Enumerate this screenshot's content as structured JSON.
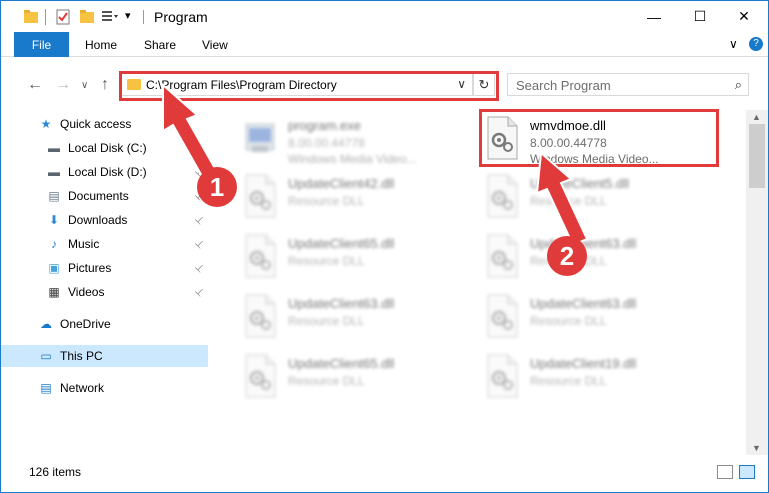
{
  "window": {
    "title": "Program",
    "controls": {
      "minimize": "—",
      "maximize": "☐",
      "close": "✕"
    }
  },
  "ribbon": {
    "tabs": [
      "File",
      "Home",
      "Share",
      "View"
    ],
    "right_controls": {
      "collapse": "∨",
      "help": "?"
    }
  },
  "address": {
    "path": "C:\\Program Files\\Program Directory",
    "refresh_glyph": "↻",
    "chevron_glyph": "∨",
    "nav": {
      "back": "←",
      "forward": "→",
      "recent": "∨",
      "up": "↑"
    }
  },
  "search": {
    "placeholder": "Search Program",
    "icon_glyph": "⌕"
  },
  "sidebar": {
    "items": [
      {
        "label": "Quick access",
        "icon": "star-icon",
        "glyph": "★",
        "color": "#2b88d8"
      },
      {
        "label": "Local Disk (C:)",
        "icon": "drive-icon",
        "glyph": "▬",
        "color": "#5a6570",
        "pinned": true
      },
      {
        "label": "Local Disk (D:)",
        "icon": "drive-icon",
        "glyph": "▬",
        "color": "#5a6570",
        "pinned": true
      },
      {
        "label": "Documents",
        "icon": "documents-icon",
        "glyph": "▤",
        "color": "#6a7a8a",
        "pinned": true
      },
      {
        "label": "Downloads",
        "icon": "download-icon",
        "glyph": "⬇",
        "color": "#2b88d8",
        "pinned": true
      },
      {
        "label": "Music",
        "icon": "music-icon",
        "glyph": "♪",
        "color": "#2b88d8",
        "pinned": true
      },
      {
        "label": "Pictures",
        "icon": "pictures-icon",
        "glyph": "▣",
        "color": "#4aa3d8",
        "pinned": true
      },
      {
        "label": "Videos",
        "icon": "videos-icon",
        "glyph": "▦",
        "color": "#333333",
        "pinned": true
      },
      {
        "label": "OneDrive",
        "icon": "cloud-icon",
        "glyph": "☁",
        "color": "#1979ca"
      },
      {
        "label": "This PC",
        "icon": "pc-icon",
        "glyph": "▭",
        "color": "#1979ca",
        "selected": true
      },
      {
        "label": "Network",
        "icon": "network-icon",
        "glyph": "▤",
        "color": "#1979ca"
      }
    ],
    "pin_glyph": "📌"
  },
  "files": [
    {
      "name": "program.exe",
      "line2": "8.00.00.44778",
      "line3": "Windows Media Video...",
      "blurred": true
    },
    {
      "name": "wmvdmoe.dll",
      "line2": "8.00.00.44778",
      "line3": "Windows Media Video...",
      "blurred": false
    },
    {
      "name": "UpdateClient42.dll",
      "line2": "Resource DLL",
      "blurred": true
    },
    {
      "name": "UpdateClient5.dll",
      "line2": "Resource DLL",
      "blurred": true
    },
    {
      "name": "UpdateClient65.dll",
      "line2": "Resource DLL",
      "blurred": true
    },
    {
      "name": "UpdateClient63.dll",
      "line2": "Resource DLL",
      "blurred": true
    },
    {
      "name": "UpdateClient63.dll",
      "line2": "Resource DLL",
      "blurred": true
    },
    {
      "name": "UpdateClient63.dll",
      "line2": "Resource DLL",
      "blurred": true
    },
    {
      "name": "UpdateClient65.dll",
      "line2": "Resource DLL",
      "blurred": true
    },
    {
      "name": "UpdateClient19.dll",
      "line2": "Resource DLL",
      "blurred": true
    }
  ],
  "status": {
    "count": "126 items"
  },
  "callouts": {
    "one": "1",
    "two": "2"
  },
  "colors": {
    "accent": "#1979ca",
    "annotation": "#e03a3a",
    "selected": "#cce8ff"
  }
}
